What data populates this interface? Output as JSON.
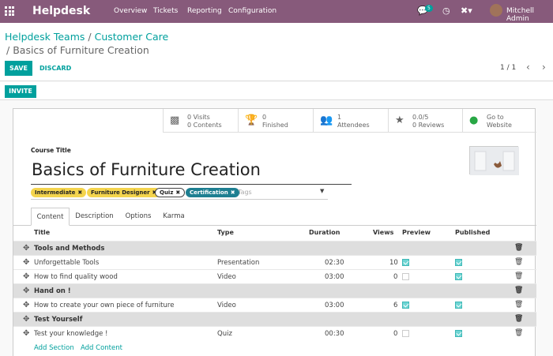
{
  "navbar": {
    "app_name": "Helpdesk",
    "menu": [
      "Overview",
      "Tickets",
      "Reporting",
      "Configuration"
    ],
    "messages_count": "5",
    "user_name": "Mitchell Admin",
    "color": "#875a7b"
  },
  "breadcrumb": {
    "root": "Helpdesk Teams",
    "separator": "/",
    "parent": "Customer Care",
    "current": "Basics of Furniture Creation"
  },
  "actions": {
    "save": "SAVE",
    "discard": "DISCARD",
    "pager": "1 / 1",
    "invite": "INVITE"
  },
  "stats": [
    {
      "icon": "puzzle-icon",
      "line1": "0 Visits",
      "line2": "0 Contents"
    },
    {
      "icon": "trophy-icon",
      "line1": "0",
      "line2": "Finished"
    },
    {
      "icon": "users-icon",
      "line1": "1",
      "line2": "Attendees"
    },
    {
      "icon": "star-icon",
      "line1": "0.0/5",
      "line2": "0 Reviews"
    },
    {
      "icon": "globe-icon",
      "line1": "Go to",
      "line2": "Website"
    }
  ],
  "form": {
    "course_title_label": "Course Title",
    "course_title": "Basics of Furniture Creation",
    "tags": [
      {
        "label": "Intermediate",
        "color": "#f4d44d"
      },
      {
        "label": "Furniture Designer",
        "color": "#f4d44d"
      },
      {
        "label": "Quiz",
        "color": "#ffffff"
      },
      {
        "label": "Certification",
        "color": "#1e7f91"
      }
    ],
    "tags_placeholder": "Tags"
  },
  "tabs": [
    "Content",
    "Description",
    "Options",
    "Karma"
  ],
  "table": {
    "headers": {
      "title": "Title",
      "type": "Type",
      "duration": "Duration",
      "views": "Views",
      "preview": "Preview",
      "published": "Published"
    },
    "rows": [
      {
        "kind": "section",
        "title": "Tools and Methods"
      },
      {
        "kind": "line",
        "title": "Unforgettable Tools",
        "type": "Presentation",
        "duration": "02:30",
        "views": "10",
        "preview": true,
        "published": true
      },
      {
        "kind": "line",
        "title": "How to find quality wood",
        "type": "Video",
        "duration": "03:00",
        "views": "0",
        "preview": false,
        "published": true
      },
      {
        "kind": "section",
        "title": "Hand on !"
      },
      {
        "kind": "line",
        "title": "How to create your own piece of furniture",
        "type": "Video",
        "duration": "03:00",
        "views": "6",
        "preview": true,
        "published": true
      },
      {
        "kind": "section",
        "title": "Test Yourself"
      },
      {
        "kind": "line",
        "title": "Test your knowledge !",
        "type": "Quiz",
        "duration": "00:30",
        "views": "0",
        "preview": false,
        "published": true
      }
    ],
    "add_section": "Add Section",
    "add_content": "Add Content"
  }
}
